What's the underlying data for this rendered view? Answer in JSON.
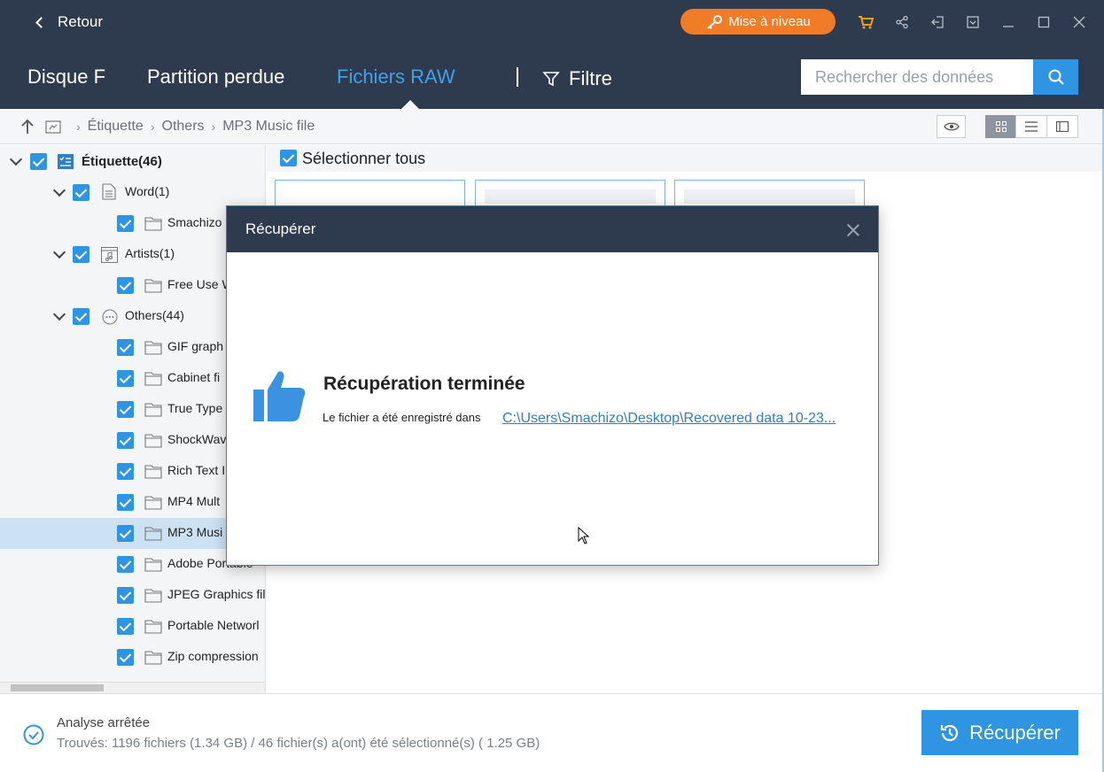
{
  "titlebar": {
    "back_label": "Retour",
    "upgrade_label": "Mise à niveau",
    "icons": [
      "cart-icon",
      "share-icon",
      "login-icon",
      "menu-icon",
      "minimize-icon",
      "maximize-icon",
      "close-icon"
    ]
  },
  "nav": {
    "tabs": [
      {
        "label": "Disque F",
        "active": false
      },
      {
        "label": "Partition perdue",
        "active": false
      },
      {
        "label": "Fichiers RAW",
        "active": true
      }
    ],
    "filter_label": "Filtre",
    "search_placeholder": "Rechercher des données"
  },
  "breadcrumb": {
    "items": [
      "Étiquette",
      "Others",
      "MP3 Music file"
    ]
  },
  "tree": {
    "root": {
      "label": "Étiquette(46)"
    },
    "groups": [
      {
        "label": "Word(1)",
        "children": [
          "Smachizo"
        ]
      },
      {
        "label": "Artists(1)",
        "children": [
          "Free Use W"
        ]
      },
      {
        "label": "Others(44)",
        "children": [
          "GIF graph",
          "Cabinet fi",
          "True Type",
          "ShockWav",
          "Rich Text I",
          "MP4 Mult",
          "MP3 Musi",
          "Adobe Portable",
          "JPEG Graphics fil",
          "Portable Networl",
          "Zip compression"
        ]
      }
    ],
    "selected_item": "MP3 Musi"
  },
  "content": {
    "select_all_label": "Sélectionner tous"
  },
  "dialog": {
    "title": "Récupérer",
    "heading": "Récupération terminée",
    "text": "Le fichier a été enregistré dans",
    "path_link": "C:\\Users\\Smachizo\\Desktop\\Recovered data 10-23..."
  },
  "status": {
    "title": "Analyse arrêtée",
    "detail": "Trouvés: 1196 fichiers (1.34 GB) / 46 fichier(s) a(ont) été sélectionné(s) ( 1.25 GB)",
    "recover_label": "Récupérer"
  },
  "colors": {
    "header_bg": "#2e3b4e",
    "accent": "#2f95e3",
    "upgrade": "#f07c28",
    "active_tab": "#3fa1e8",
    "selected_row": "#cde1f5"
  }
}
